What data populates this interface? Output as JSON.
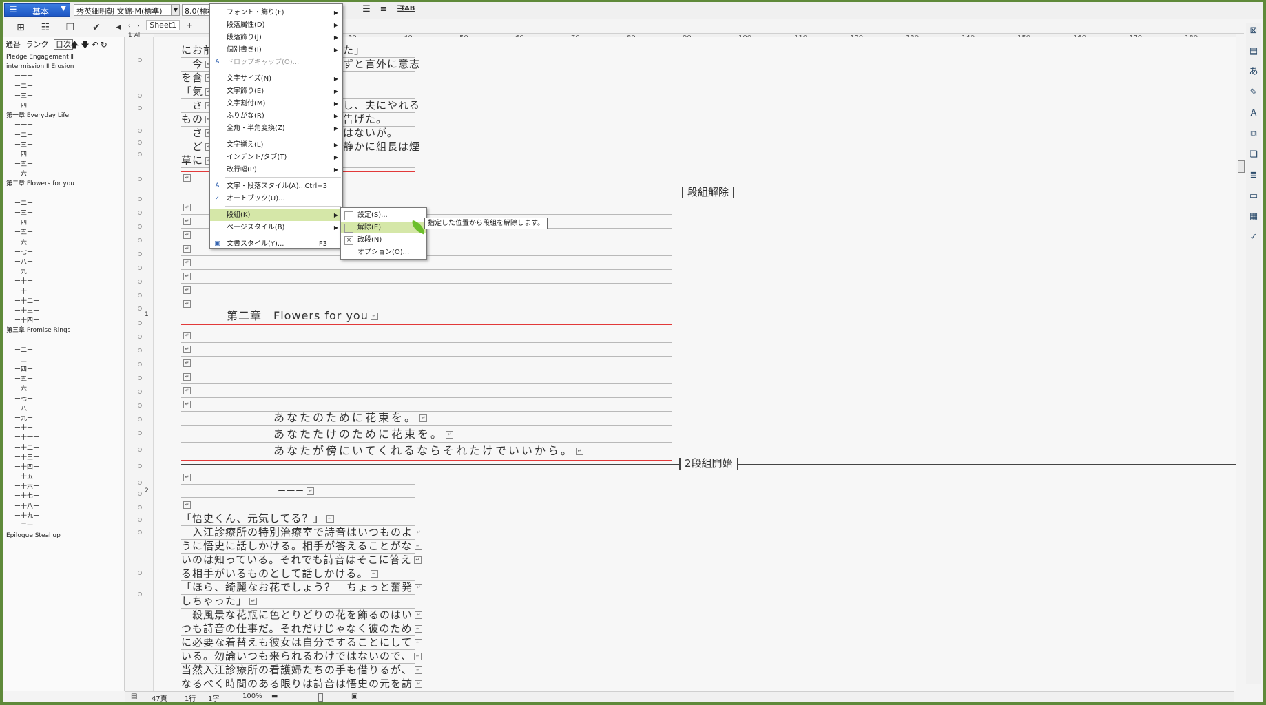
{
  "toolbar": {
    "style_label": "基本",
    "font_name": "秀英細明朝 文錦-M(標準)",
    "font_size": "8.0(標準",
    "tab_label": "TAB"
  },
  "sheet": {
    "tab_label": "Sheet1",
    "page_indicator": "1 All"
  },
  "outline": {
    "tabs": [
      "通番",
      "ランク",
      "目次"
    ],
    "items": [
      {
        "text": "Pledge Engagement Ⅱ",
        "sub": false
      },
      {
        "text": "intermission Ⅱ Erosion",
        "sub": false
      },
      {
        "text": "ー一ー",
        "sub": true
      },
      {
        "text": "ー二ー",
        "sub": true
      },
      {
        "text": "ー三ー",
        "sub": true
      },
      {
        "text": "ー四ー",
        "sub": true
      },
      {
        "text": "第一章 Everyday Life",
        "sub": false
      },
      {
        "text": "ー一ー",
        "sub": true
      },
      {
        "text": "ー二ー",
        "sub": true
      },
      {
        "text": "ー三ー",
        "sub": true
      },
      {
        "text": "ー四ー",
        "sub": true
      },
      {
        "text": "ー五ー",
        "sub": true
      },
      {
        "text": "ー六ー",
        "sub": true
      },
      {
        "text": "第二章 Flowers for you",
        "sub": false
      },
      {
        "text": "ー一ー",
        "sub": true
      },
      {
        "text": "ー二ー",
        "sub": true
      },
      {
        "text": "ー三ー",
        "sub": true
      },
      {
        "text": "ー四ー",
        "sub": true
      },
      {
        "text": "ー五ー",
        "sub": true
      },
      {
        "text": "ー六ー",
        "sub": true
      },
      {
        "text": "ー七ー",
        "sub": true
      },
      {
        "text": "ー八ー",
        "sub": true
      },
      {
        "text": "ー九ー",
        "sub": true
      },
      {
        "text": "ー十ー",
        "sub": true
      },
      {
        "text": "ー十一ー",
        "sub": true
      },
      {
        "text": "ー十二ー",
        "sub": true
      },
      {
        "text": "ー十三ー",
        "sub": true
      },
      {
        "text": "ー十四ー",
        "sub": true
      },
      {
        "text": "第三章 Promise Rings",
        "sub": false
      },
      {
        "text": "ー一ー",
        "sub": true
      },
      {
        "text": "ー二ー",
        "sub": true
      },
      {
        "text": "ー三ー",
        "sub": true
      },
      {
        "text": "ー四ー",
        "sub": true
      },
      {
        "text": "ー五ー",
        "sub": true
      },
      {
        "text": "ー六ー",
        "sub": true
      },
      {
        "text": "ー七ー",
        "sub": true
      },
      {
        "text": "ー八ー",
        "sub": true
      },
      {
        "text": "ー九ー",
        "sub": true
      },
      {
        "text": "ー十ー",
        "sub": true
      },
      {
        "text": "ー十一ー",
        "sub": true
      },
      {
        "text": "ー十二ー",
        "sub": true
      },
      {
        "text": "ー十三ー",
        "sub": true
      },
      {
        "text": "ー十四ー",
        "sub": true
      },
      {
        "text": "ー十五ー",
        "sub": true
      },
      {
        "text": "ー十六ー",
        "sub": true
      },
      {
        "text": "ー十七ー",
        "sub": true
      },
      {
        "text": "ー十八ー",
        "sub": true
      },
      {
        "text": "ー十九ー",
        "sub": true
      },
      {
        "text": "ー二十ー",
        "sub": true
      },
      {
        "text": "Epilogue Steal up",
        "sub": false
      }
    ]
  },
  "ruler": [
    "30",
    "40",
    "50",
    "60",
    "70",
    "80",
    "90",
    "100",
    "110",
    "120",
    "130",
    "140",
    "150",
    "160",
    "170",
    "180"
  ],
  "editor": {
    "top_lines": [
      "にお前",
      "　今",
      "を含",
      "「気",
      "　さ",
      "もの",
      "　さ",
      "　ど",
      "草に"
    ],
    "top_lines_right": [
      "た」",
      "ずと言外に意志",
      "",
      "",
      "し、夫にやれる",
      "告げた。",
      "はないが。",
      "静かに組長は煙",
      ""
    ],
    "marker1": "段組解除",
    "chapter_heading": "第二章　Flowers for you",
    "poem": [
      "あなたのために花束を。",
      "あなたたけのために花束を。",
      "あなたが傍にいてくれるならそれたけでいいから。"
    ],
    "marker2": "2段組開始",
    "section_num": "ー一ー",
    "body_lines": [
      "「悟史くん、元気してる？」",
      "　入江診療所の特別治療室で詩音はいつものよ",
      "うに悟史に話しかける。相手が答えることがな",
      "いのは知っている。それでも詩音はそこに答え",
      "る相手がいるものとして話しかける。",
      "「ほら、綺麗なお花でしょう？　ちょっと奮発",
      "しちゃった」",
      "　殺風景な花瓶に色とりどりの花を飾るのはい",
      "つも詩音の仕事だ。それだけじゃなく彼のため",
      "に必要な着替えも彼女は自分ですることにして",
      "いる。勿論いつも来られるわけではないので、",
      "当然入江診療所の看護婦たちの手も借りるが、",
      "なるべく時間のある限りは詩音は悟史の元を訪"
    ],
    "para_num_1": "1",
    "para_num_2": "2"
  },
  "menu": {
    "items": [
      {
        "label": "フォント・飾り(F)",
        "arrow": true
      },
      {
        "label": "段落属性(D)",
        "arrow": true
      },
      {
        "label": "段落飾り(J)",
        "arrow": true
      },
      {
        "label": "個別書き(I)",
        "arrow": true
      },
      {
        "label": "ドロップキャップ(O)...",
        "disabled": true
      },
      {
        "label": "文字サイズ(N)",
        "arrow": true
      },
      {
        "label": "文字飾り(E)",
        "arrow": true
      },
      {
        "label": "文字割付(M)",
        "arrow": true
      },
      {
        "label": "ふりがな(R)",
        "arrow": true
      },
      {
        "label": "全角・半角変換(Z)",
        "arrow": true
      },
      {
        "label": "文字揃え(L)",
        "arrow": true
      },
      {
        "label": "インデント/タブ(T)",
        "arrow": true
      },
      {
        "label": "改行幅(P)",
        "arrow": true
      },
      {
        "label": "文字・段落スタイル(A)...",
        "shortcut": "Ctrl+3"
      },
      {
        "label": "オートブック(U)..."
      },
      {
        "label": "段組(K)",
        "arrow": true,
        "highlight": true
      },
      {
        "label": "ページスタイル(B)",
        "arrow": true
      },
      {
        "label": "文書スタイル(Y)...",
        "shortcut": "F3"
      }
    ]
  },
  "submenu": {
    "items": [
      "設定(S)...",
      "解除(E)",
      "改段(N)",
      "オプション(O)..."
    ],
    "tooltip": "指定した位置から段組を解除します。"
  },
  "status": {
    "pages": "47頁",
    "line": "1行",
    "char": "1字",
    "zoom": "100%"
  }
}
